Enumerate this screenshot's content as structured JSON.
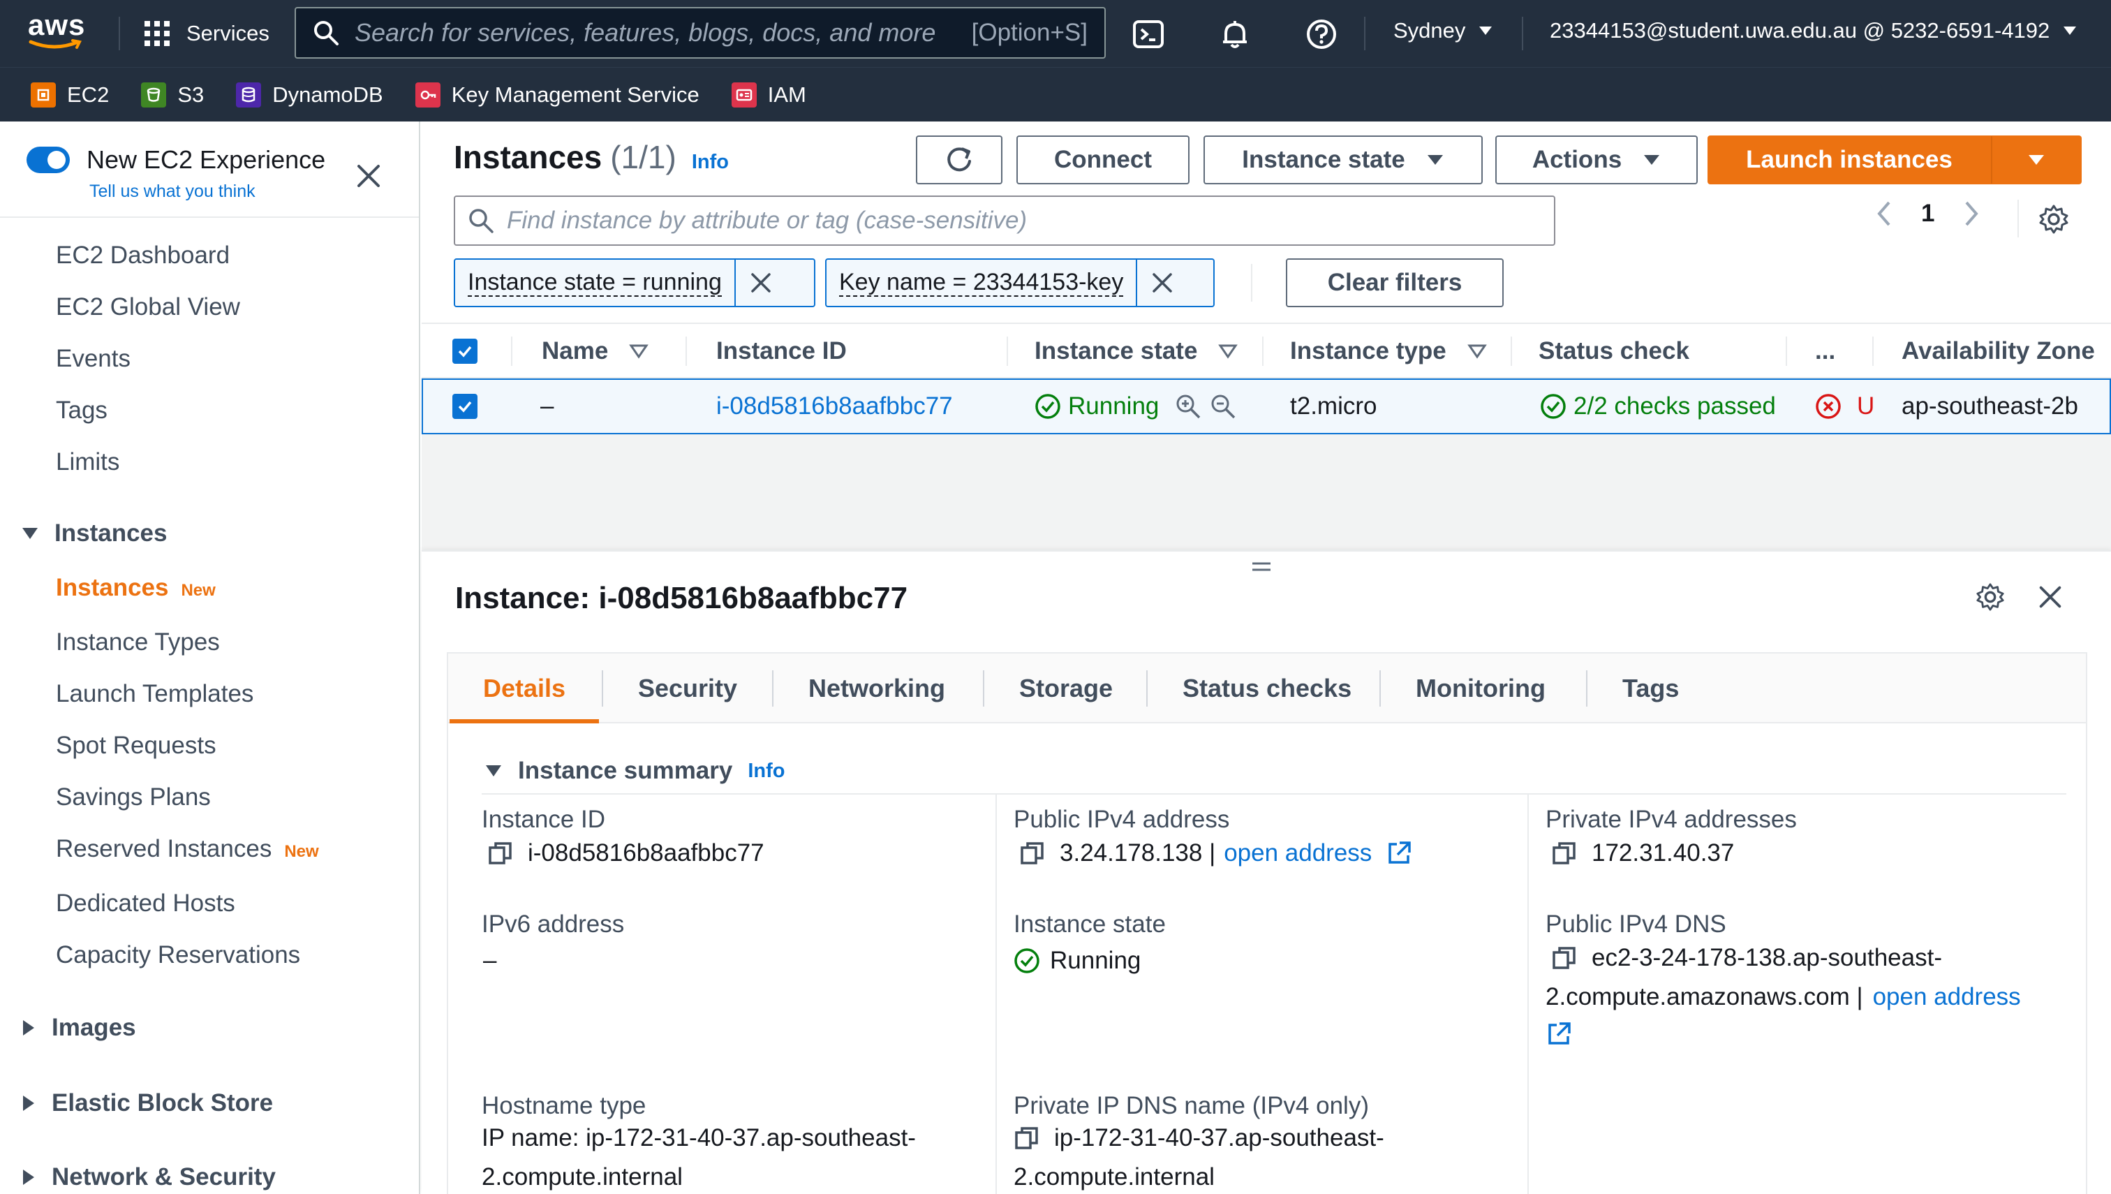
{
  "topnav": {
    "logo_text": "aws",
    "services_label": "Services",
    "search_placeholder": "Search for services, features, blogs, docs, and more",
    "search_shortcut": "[Option+S]",
    "region": "Sydney",
    "account": "23344153@student.uwa.edu.au @ 5232-6591-4192",
    "icons": [
      "cloudshell-icon",
      "bell-icon",
      "help-icon"
    ]
  },
  "favorites": [
    {
      "label": "EC2",
      "icon": "ec2-icon",
      "color": "#ed7100"
    },
    {
      "label": "S3",
      "icon": "s3-icon",
      "color": "#3f8624"
    },
    {
      "label": "DynamoDB",
      "icon": "dynamodb-icon",
      "color": "#4d27aa"
    },
    {
      "label": "Key Management Service",
      "icon": "kms-icon",
      "color": "#dd344c"
    },
    {
      "label": "IAM",
      "icon": "iam-icon",
      "color": "#dd344c"
    }
  ],
  "sidebar": {
    "experience_title": "New EC2 Experience",
    "experience_link": "Tell us what you think",
    "items": [
      {
        "label": "EC2 Dashboard"
      },
      {
        "label": "EC2 Global View"
      },
      {
        "label": "Events"
      },
      {
        "label": "Tags"
      },
      {
        "label": "Limits"
      }
    ],
    "sections": [
      {
        "label": "Instances"
      },
      {
        "label": "Images"
      },
      {
        "label": "Elastic Block Store"
      },
      {
        "label": "Network & Security"
      }
    ],
    "instances_items": [
      {
        "label": "Instances",
        "badge": "New"
      },
      {
        "label": "Instance Types"
      },
      {
        "label": "Launch Templates"
      },
      {
        "label": "Spot Requests"
      },
      {
        "label": "Savings Plans"
      },
      {
        "label": "Reserved Instances",
        "badge": "New"
      },
      {
        "label": "Dedicated Hosts"
      },
      {
        "label": "Capacity Reservations"
      }
    ]
  },
  "main": {
    "title": "Instances",
    "count": "(1/1)",
    "info": "Info",
    "buttons": {
      "connect": "Connect",
      "instance_state": "Instance state",
      "actions": "Actions",
      "launch": "Launch instances"
    },
    "filter_placeholder": "Find instance by attribute or tag (case-sensitive)",
    "page_number": "1",
    "tokens": [
      "Instance state = running",
      "Key name = 23344153-key"
    ],
    "clear_filters": "Clear filters",
    "columns": [
      "Name",
      "Instance ID",
      "Instance state",
      "Instance type",
      "Status check",
      "...",
      "Availability Zone"
    ],
    "row": {
      "name": "–",
      "instance_id": "i-08d5816b8aafbbc77",
      "state": "Running",
      "type": "t2.micro",
      "status_check": "2/2 checks passed",
      "alarm": "U",
      "az": "ap-southeast-2b"
    }
  },
  "detail": {
    "title": "Instance: i-08d5816b8aafbbc77",
    "tabs": [
      "Details",
      "Security",
      "Networking",
      "Storage",
      "Status checks",
      "Monitoring",
      "Tags"
    ],
    "section": "Instance summary",
    "section_info": "Info",
    "fields": {
      "instance_id_label": "Instance ID",
      "instance_id_value": "i-08d5816b8aafbbc77",
      "public_ipv4_label": "Public IPv4 address",
      "public_ipv4_value": "3.24.178.138 |",
      "open_address": "open address",
      "private_ipv4_label": "Private IPv4 addresses",
      "private_ipv4_value": "172.31.40.37",
      "ipv6_label": "IPv6 address",
      "ipv6_value": "–",
      "state_label": "Instance state",
      "state_value": "Running",
      "public_dns_label": "Public IPv4 DNS",
      "public_dns_line1": "ec2-3-24-178-138.ap-southeast-",
      "public_dns_line2": "2.compute.amazonaws.com |",
      "hostname_label": "Hostname type",
      "hostname_line1": "IP name: ip-172-31-40-37.ap-southeast-",
      "hostname_line2": "2.compute.internal",
      "private_dns_label": "Private IP DNS name (IPv4 only)",
      "private_dns_line1": "ip-172-31-40-37.ap-southeast-",
      "private_dns_line2": "2.compute.internal"
    }
  },
  "colors": {
    "nav_bg": "#232f3e",
    "accent_orange": "#ec7211",
    "link_blue": "#0972d3",
    "success_green": "#037f0c",
    "error_red": "#d91515"
  }
}
